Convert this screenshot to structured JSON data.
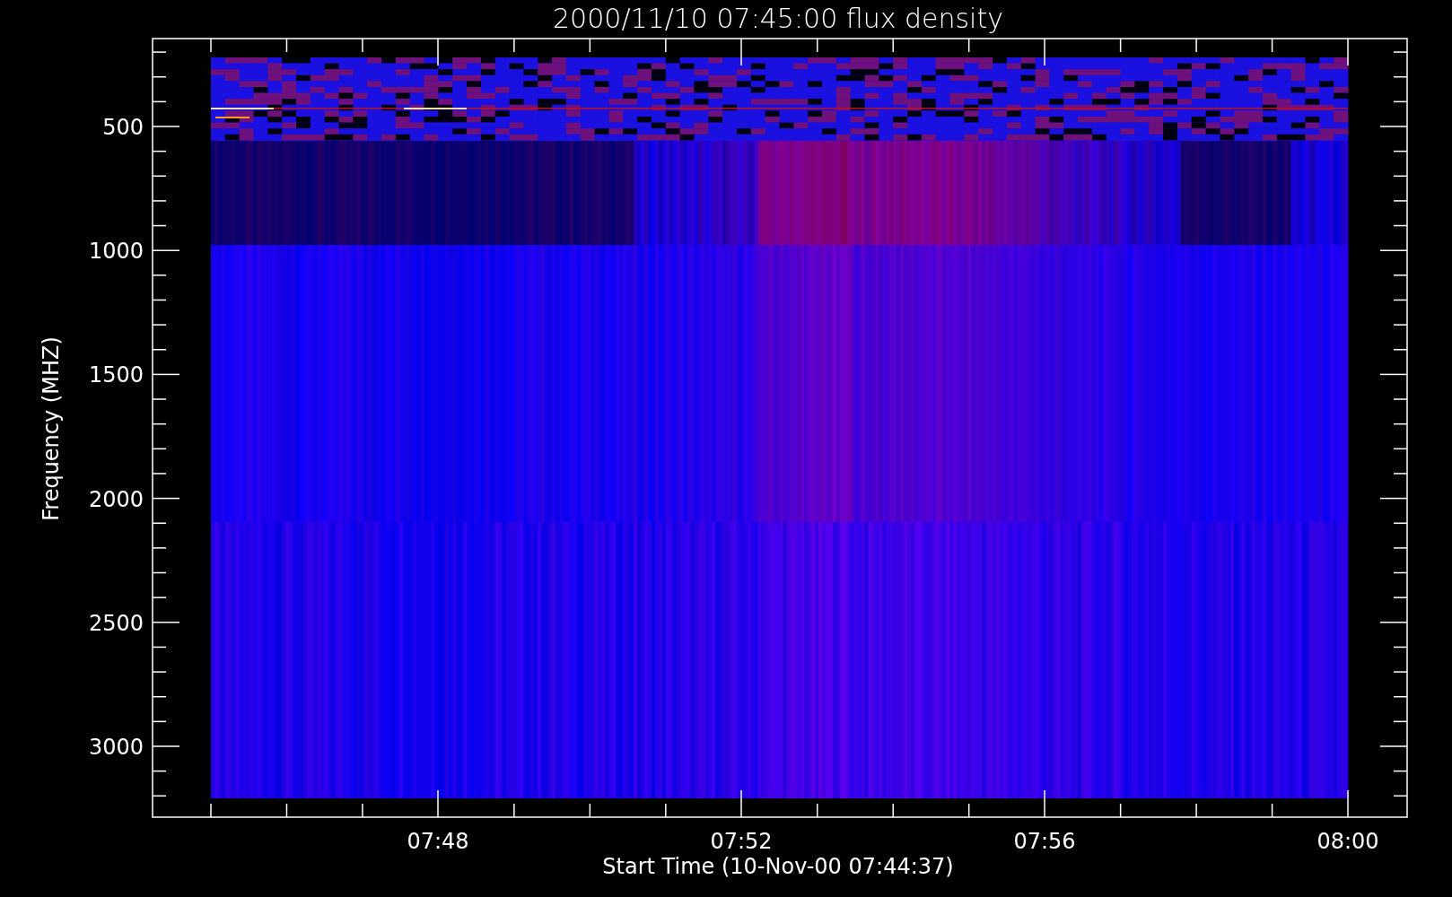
{
  "plot": {
    "title": "2000/11/10 07:45:00 flux density",
    "xlabel": "Start Time (10-Nov-00 07:44:37)",
    "ylabel": "Frequency (MHZ)",
    "xticks": [
      "07:48",
      "07:52",
      "07:56",
      "08:00"
    ],
    "yticks": [
      "500",
      "1000",
      "1500",
      "2000",
      "2500",
      "3000"
    ]
  }
}
